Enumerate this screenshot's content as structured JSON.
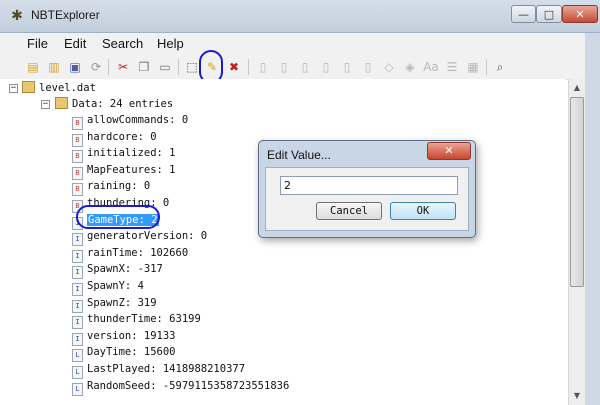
{
  "window": {
    "title": "NBTExplorer",
    "minimize_glyph": "—",
    "maximize_glyph": "□",
    "close_glyph": "✕"
  },
  "menu": [
    "File",
    "Edit",
    "Search",
    "Help"
  ],
  "toolbar_icons": [
    "open-file-icon",
    "open-folder-icon",
    "save-icon",
    "refresh-icon",
    "cut-icon",
    "copy-icon",
    "paste-icon",
    "rename-icon",
    "edit-value-icon",
    "delete-icon",
    "add-byte-tag-icon",
    "add-short-tag-icon",
    "add-int-tag-icon",
    "add-long-tag-icon",
    "add-float-tag-icon",
    "add-double-tag-icon",
    "add-byte-array-icon",
    "add-int-array-icon",
    "add-string-tag-icon",
    "add-list-tag-icon",
    "add-compound-tag-icon",
    "find-icon"
  ],
  "tree": {
    "root": "level.dat",
    "data_node": "Data: 24 entries",
    "entries": [
      {
        "label": "allowCommands: 0",
        "type": "B"
      },
      {
        "label": "hardcore: 0",
        "type": "B"
      },
      {
        "label": "initialized: 1",
        "type": "B"
      },
      {
        "label": "MapFeatures: 1",
        "type": "B"
      },
      {
        "label": "raining: 0",
        "type": "B"
      },
      {
        "label": "thundering: 0",
        "type": "B"
      },
      {
        "label": "GameType: 2",
        "type": "I",
        "selected": true
      },
      {
        "label": "generatorVersion: 0",
        "type": "I"
      },
      {
        "label": "rainTime: 102660",
        "type": "I"
      },
      {
        "label": "SpawnX: -317",
        "type": "I"
      },
      {
        "label": "SpawnY: 4",
        "type": "I"
      },
      {
        "label": "SpawnZ: 319",
        "type": "I"
      },
      {
        "label": "thunderTime: 63199",
        "type": "I"
      },
      {
        "label": "version: 19133",
        "type": "I"
      },
      {
        "label": "DayTime: 15600",
        "type": "L"
      },
      {
        "label": "LastPlayed: 1418988210377",
        "type": "L"
      },
      {
        "label": "RandomSeed: -5979115358723551836",
        "type": "L"
      }
    ]
  },
  "dialog": {
    "title": "Edit Value...",
    "close_glyph": "✕",
    "value": "2",
    "cancel_label": "Cancel",
    "ok_label": "OK"
  },
  "colors": {
    "selection": "#3399ff",
    "annotation": "#1a1ad6"
  }
}
